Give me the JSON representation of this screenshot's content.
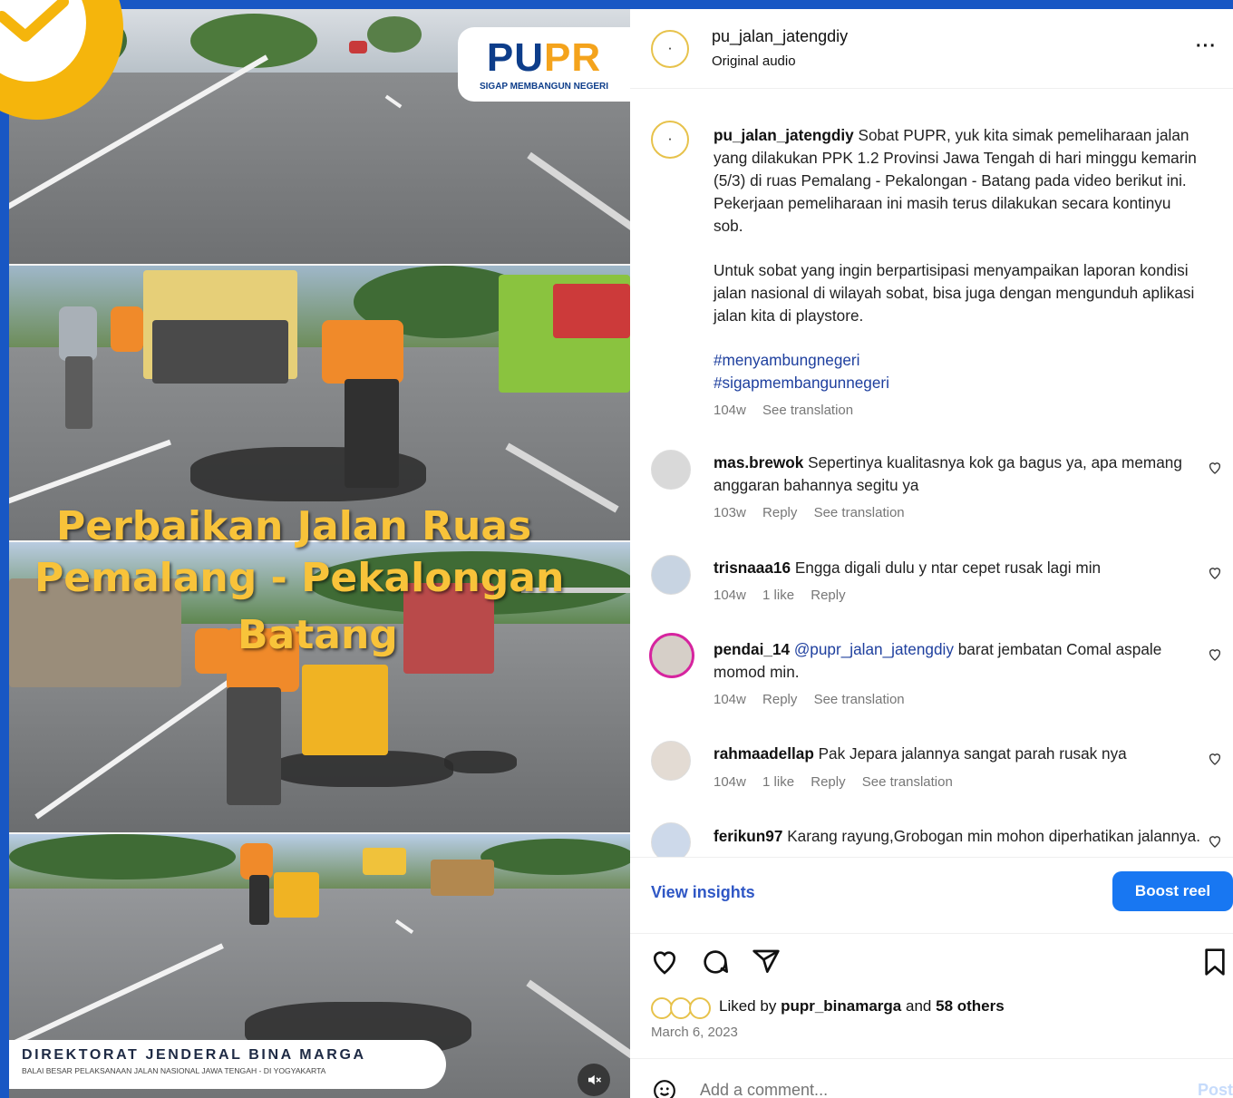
{
  "media": {
    "logo_pu": "PU",
    "logo_pr": "PR",
    "logo_tagline": "SIGAP MEMBANGUN NEGERI",
    "headline_line1": "Perbaikan Jalan Ruas",
    "headline_line2": "Pemalang - Pekalongan",
    "headline_line3": "Batang",
    "footer_title": "DIREKTORAT JENDERAL BINA MARGA",
    "footer_subtitle": "BALAI BESAR PELAKSANAAN JALAN NASIONAL JAWA TENGAH - DI YOGYAKARTA",
    "mute_icon": "speaker-muted-icon",
    "badge_icon": "checkmark-icon"
  },
  "header": {
    "username": "pu_jalan_jatengdiy",
    "audio": "Original audio",
    "more_icon": "···"
  },
  "caption": {
    "username": "pu_jalan_jatengdiy",
    "paragraph1": "Sobat PUPR, yuk kita simak pemeliharaan jalan yang dilakukan PPK 1.2 Provinsi Jawa Tengah di hari minggu kemarin (5/3) di ruas Pemalang - Pekalongan - Batang pada video berikut ini. Pekerjaan pemeliharaan ini masih terus dilakukan secara kontinyu sob.",
    "paragraph2": "Untuk sobat yang ingin berpartisipasi menyampaikan laporan kondisi jalan nasional di wilayah sobat, bisa juga dengan mengunduh aplikasi jalan kita di playstore.",
    "hashtag1": "#menyambungnegeri",
    "hashtag2": "#sigapmembangunnegeri",
    "time": "104w",
    "see_translation": "See translation"
  },
  "comments": [
    {
      "username": "mas.brewok",
      "text": "Sepertinya kualitasnya kok ga bagus ya, apa memang anggaran bahannya segitu ya",
      "time": "103w",
      "likes": "",
      "reply": "Reply",
      "translation": "See translation"
    },
    {
      "username": "trisnaaa16",
      "text": "Engga digali dulu y ntar cepet rusak lagi min",
      "time": "104w",
      "likes": "1 like",
      "reply": "Reply",
      "translation": ""
    },
    {
      "username": "pendai_14",
      "mention": "@pupr_jalan_jatengdiy",
      "text": "barat jembatan Comal aspale momod min.",
      "time": "104w",
      "likes": "",
      "reply": "Reply",
      "translation": "See translation"
    },
    {
      "username": "rahmaadellap",
      "text": "Pak Jepara jalannya sangat parah rusak nya",
      "time": "104w",
      "likes": "1 like",
      "reply": "Reply",
      "translation": "See translation"
    },
    {
      "username": "ferikun97",
      "text": "Karang rayung,Grobogan min mohon diperhatikan jalannya.",
      "time": "",
      "likes": "",
      "reply": "",
      "translation": ""
    }
  ],
  "insights": {
    "view_insights": "View insights",
    "boost_reel": "Boost reel"
  },
  "actions": {
    "like_icon": "heart-icon",
    "comment_icon": "comment-icon",
    "share_icon": "send-icon",
    "save_icon": "bookmark-icon",
    "liked_prefix": "Liked by",
    "liked_user": "pupr_binamarga",
    "liked_and": "and",
    "liked_others": "58 others",
    "date": "March 6, 2023"
  },
  "comment_bar": {
    "placeholder": "Add a comment...",
    "post": "Post",
    "emoji_icon": "emoji-icon"
  },
  "colors": {
    "background": "#1857c4",
    "accent_blue": "#1877f2",
    "link_blue": "#2f57c5",
    "headline_yellow": "#f8c33a",
    "badge_yellow": "#f5b50c"
  }
}
